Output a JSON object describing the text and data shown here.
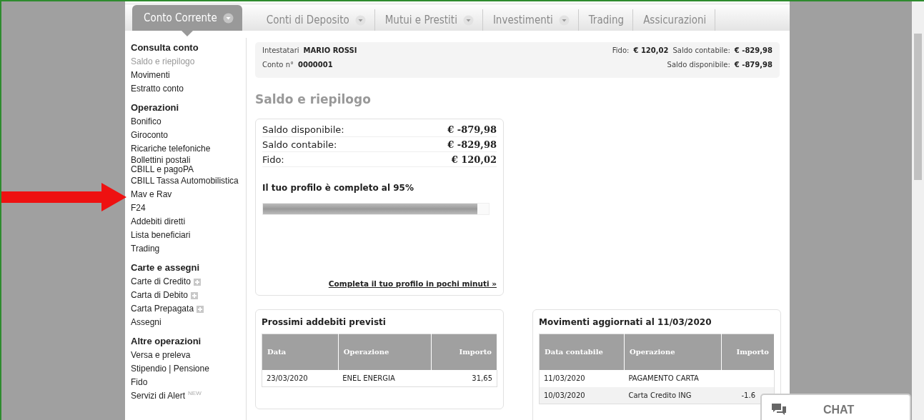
{
  "tabs": [
    {
      "label": "Conto Corrente",
      "selected": true,
      "has_menu": true
    },
    {
      "label": "Conti di Deposito",
      "selected": false,
      "has_menu": true
    },
    {
      "label": "Mutui e Prestiti",
      "selected": false,
      "has_menu": true
    },
    {
      "label": "Investimenti",
      "selected": false,
      "has_menu": true
    },
    {
      "label": "Trading",
      "selected": false,
      "has_menu": false
    },
    {
      "label": "Assicurazioni",
      "selected": false,
      "has_menu": false
    }
  ],
  "sidebar": {
    "sections": [
      {
        "heading": "Consulta conto",
        "items": [
          {
            "label": "Saldo e riepilogo",
            "selected": true
          },
          {
            "label": "Movimenti",
            "selected": false
          },
          {
            "label": "Estratto conto",
            "selected": false
          }
        ]
      },
      {
        "heading": "Operazioni",
        "items": [
          {
            "label": "Bonifico",
            "selected": false
          },
          {
            "label": "Giroconto",
            "selected": false
          },
          {
            "label": "Ricariche telefoniche",
            "selected": false
          },
          {
            "label": "Bollettini postali\nCBILL e pagoPA",
            "selected": false
          },
          {
            "label": "CBILL Tassa Automobilistica",
            "selected": false
          },
          {
            "label": "Mav e Rav",
            "selected": false
          },
          {
            "label": "F24",
            "selected": false
          },
          {
            "label": "Addebiti diretti",
            "selected": false
          },
          {
            "label": "Lista beneficiari",
            "selected": false
          },
          {
            "label": "Trading",
            "selected": false
          }
        ]
      },
      {
        "heading": "Carte e assegni",
        "items": [
          {
            "label": "Carte di Credito",
            "selected": false,
            "expandable": true
          },
          {
            "label": "Carta di Debito",
            "selected": false,
            "expandable": true
          },
          {
            "label": "Carta Prepagata",
            "selected": false,
            "expandable": true
          },
          {
            "label": "Assegni",
            "selected": false
          }
        ]
      },
      {
        "heading": "Altre operazioni",
        "items": [
          {
            "label": "Versa e preleva",
            "selected": false
          },
          {
            "label": "Stipendio | Pensione",
            "selected": false
          },
          {
            "label": "Fido",
            "selected": false
          },
          {
            "label": "Servizi di Alert",
            "selected": false,
            "badge": "NEW"
          }
        ]
      }
    ]
  },
  "account_bar": {
    "holder_label": "Intestatari",
    "holder": "MARIO ROSSI",
    "account_label": "Conto n°",
    "account": "0000001",
    "fido_label": "Fido:",
    "fido": "€ 120,02",
    "contabile_label": "Saldo contabile:",
    "contabile": "€ -829,98",
    "disponibile_label": "Saldo disponibile:",
    "disponibile": "€ -879,98"
  },
  "page_title": "Saldo e riepilogo",
  "summary": {
    "rows": [
      {
        "label": "Saldo disponibile:",
        "value": "€ -879,98"
      },
      {
        "label": "Saldo contabile:",
        "value": "€ -829,98"
      },
      {
        "label": "Fido:",
        "value": "€ 120,02"
      }
    ],
    "profile_text": "Il tuo profilo è completo al 95%",
    "level": 0.95,
    "profile_link": "Completa il tuo profilo in pochi minuti »"
  },
  "upcoming": {
    "title": "Prossimi addebiti previsti",
    "columns": [
      "Data",
      "Operazione",
      "Importo"
    ],
    "rows": [
      [
        "23/03/2020",
        "ENEL ENERGIA",
        "31,65"
      ]
    ]
  },
  "movements": {
    "title": "Movimenti aggiornati al 11/03/2020",
    "columns": [
      "Data contabile",
      "Operazione",
      "Importo"
    ],
    "rows": [
      [
        "11/03/2020",
        "PAGAMENTO CARTA",
        ""
      ],
      [
        "10/03/2020",
        "Carta Credito ING",
        "-1.6"
      ]
    ]
  },
  "chat": {
    "label": "CHAT"
  }
}
